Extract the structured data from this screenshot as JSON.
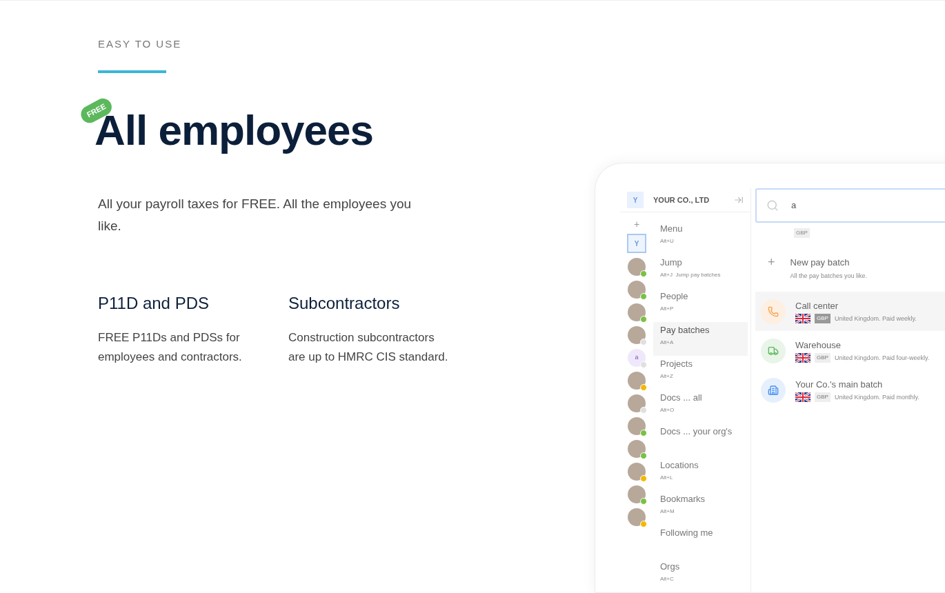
{
  "eyebrow": "EASY TO USE",
  "badge": "FREE",
  "heading": "All employees",
  "intro": "All your payroll taxes for FREE. All the employees you like.",
  "features": [
    {
      "title": "P11D and PDS",
      "text": "FREE P11Ds and PDSs for employees and contractors."
    },
    {
      "title": "Subcontractors",
      "text": "Construction subcontractors are up to HMRC CIS standard."
    }
  ],
  "app": {
    "org": {
      "logo": "Y",
      "name": "YOUR CO., LTD"
    },
    "rail": [
      {
        "kind": "add",
        "label": "+"
      },
      {
        "kind": "workspace",
        "label": "Y",
        "selected": true
      },
      {
        "kind": "photo",
        "color": "#7ac143"
      },
      {
        "kind": "photo",
        "color": "#7ac143"
      },
      {
        "kind": "photo",
        "color": "#7ac143"
      },
      {
        "kind": "photo",
        "color": "#e0e0e0"
      },
      {
        "kind": "letter",
        "label": "a",
        "color": "#e0e0e0"
      },
      {
        "kind": "photo",
        "color": "#f5b800"
      },
      {
        "kind": "photo",
        "color": "#e0e0e0"
      },
      {
        "kind": "photo",
        "color": "#7ac143"
      },
      {
        "kind": "photo",
        "color": "#7ac143"
      },
      {
        "kind": "photo",
        "color": "#f5b800"
      },
      {
        "kind": "photo",
        "color": "#7ac143"
      },
      {
        "kind": "photo",
        "color": "#f5b800"
      }
    ],
    "menu": [
      {
        "label": "Menu",
        "shortcut": "Alt+U",
        "selected": false
      },
      {
        "label": "Jump",
        "shortcut": "Alt+J  Jump pay batches",
        "selected": false
      },
      {
        "label": "People",
        "shortcut": "Alt+P",
        "selected": false
      },
      {
        "label": "Pay batches",
        "shortcut": "Alt+A",
        "selected": true
      },
      {
        "label": "Projects",
        "shortcut": "Alt+Z",
        "selected": false
      },
      {
        "label": "Docs ... all",
        "shortcut": "Alt+O",
        "selected": false
      },
      {
        "label": "Docs ... your org's",
        "selected": false
      },
      {
        "label": "Locations",
        "shortcut": "Alt+L",
        "selected": false
      },
      {
        "label": "Bookmarks",
        "shortcut": "Alt+M",
        "selected": false
      },
      {
        "label": "Following me",
        "selected": false
      },
      {
        "label": "Orgs",
        "shortcut": "Alt+C",
        "selected": false
      }
    ],
    "search": {
      "value": "a",
      "chip": "GBP"
    },
    "new_item": {
      "icon": "+",
      "title": "New pay batch",
      "subtitle": "All the pay batches you like."
    },
    "results": [
      {
        "kind": "phone",
        "color": "#f5a04a",
        "title": "Call center",
        "currency": "GBP",
        "detail": "United Kingdom. Paid weekly.",
        "selected": true
      },
      {
        "kind": "truck",
        "color": "#5cb85c",
        "title": "Warehouse",
        "currency": "GBP",
        "detail": "United Kingdom. Paid four-weekly.",
        "selected": false
      },
      {
        "kind": "building",
        "color": "#4a8ff0",
        "title": "Your Co.'s main batch",
        "currency": "GBP",
        "detail": "United Kingdom. Paid monthly.",
        "selected": false
      }
    ]
  }
}
